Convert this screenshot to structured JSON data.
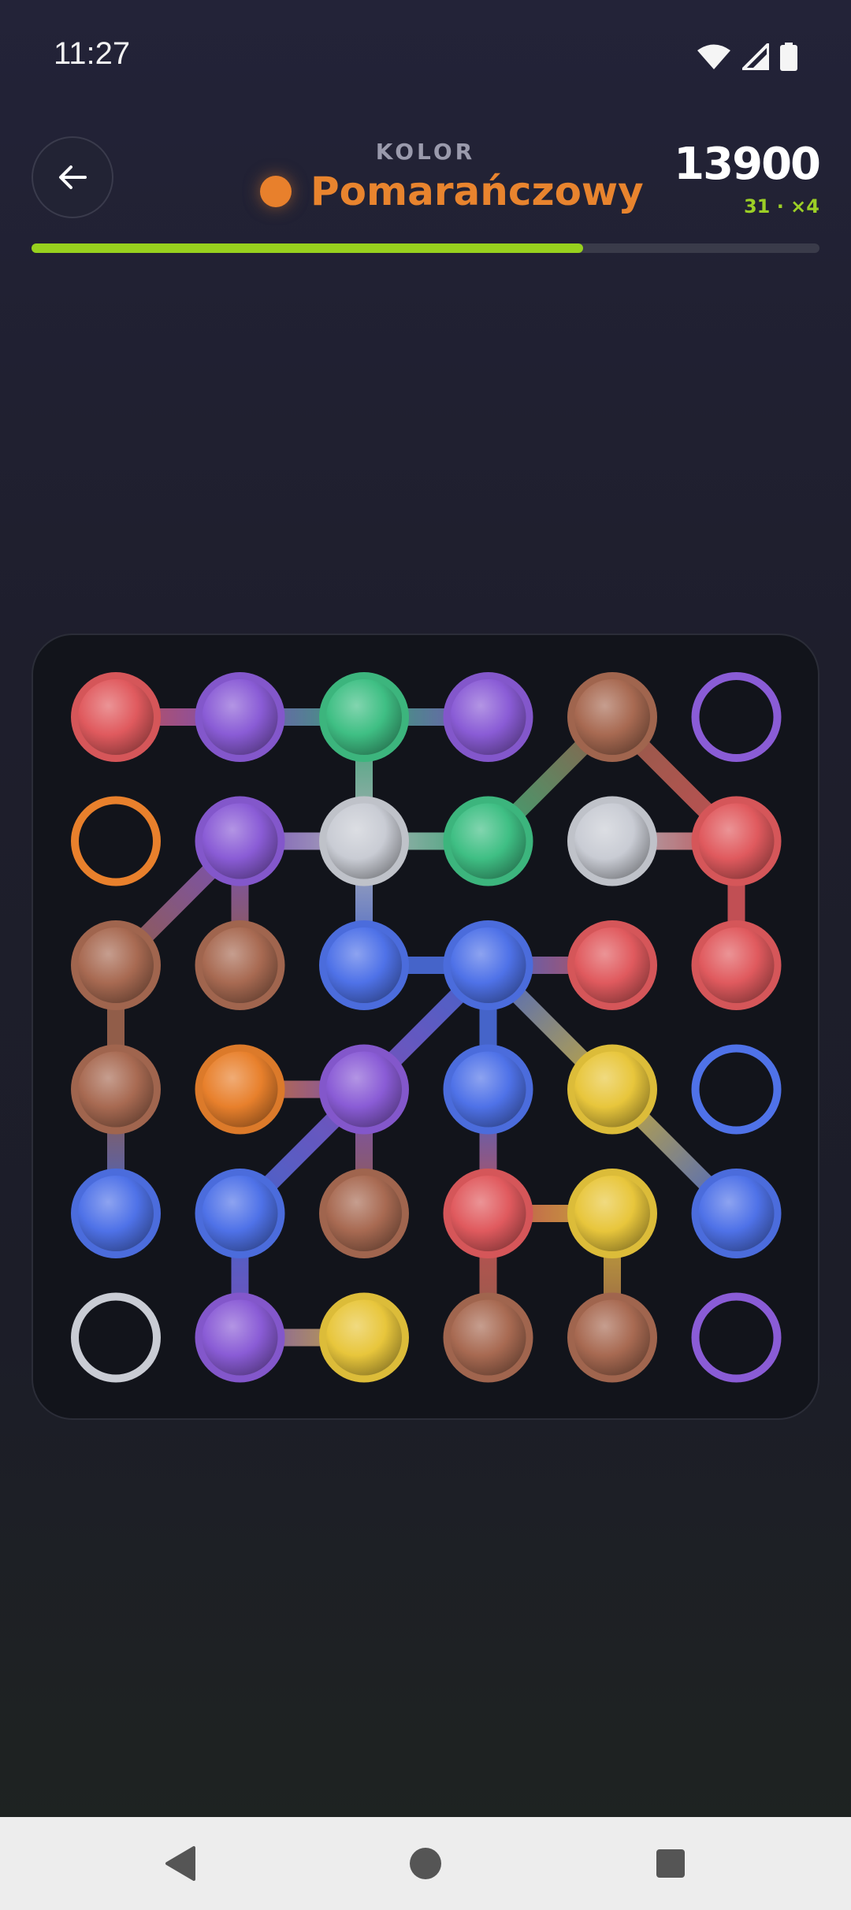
{
  "status": {
    "time": "11:27",
    "icons": [
      "wifi-icon",
      "cellular-signal-icon",
      "battery-icon"
    ]
  },
  "header": {
    "back_icon": "arrow-left-icon",
    "label": "KOLOR",
    "color_name": "Pomarańczowy",
    "color_hex": "#e8802c",
    "score": "13900",
    "combo": "31 · ×4",
    "progress": 0.7
  },
  "board": {
    "rows": 6,
    "cols": 6,
    "palette": {
      "red": "#e05a5e",
      "purple": "#8a5cd6",
      "green": "#3fbf84",
      "brown": "#a86a52",
      "white": "#c9ccd4",
      "blue": "#4f72e8",
      "orange": "#e8802c",
      "yellow": "#e8c63c"
    },
    "cells": [
      [
        {
          "c": "red",
          "f": true
        },
        {
          "c": "purple",
          "f": true
        },
        {
          "c": "green",
          "f": true
        },
        {
          "c": "purple",
          "f": true
        },
        {
          "c": "brown",
          "f": true
        },
        {
          "c": "purple",
          "f": false
        }
      ],
      [
        {
          "c": "orange",
          "f": false
        },
        {
          "c": "purple",
          "f": true
        },
        {
          "c": "white",
          "f": true
        },
        {
          "c": "green",
          "f": true
        },
        {
          "c": "white",
          "f": true
        },
        {
          "c": "red",
          "f": true
        }
      ],
      [
        {
          "c": "brown",
          "f": true
        },
        {
          "c": "brown",
          "f": true
        },
        {
          "c": "blue",
          "f": true
        },
        {
          "c": "blue",
          "f": true
        },
        {
          "c": "red",
          "f": true
        },
        {
          "c": "red",
          "f": true
        }
      ],
      [
        {
          "c": "brown",
          "f": true
        },
        {
          "c": "orange",
          "f": true
        },
        {
          "c": "purple",
          "f": true
        },
        {
          "c": "blue",
          "f": true
        },
        {
          "c": "yellow",
          "f": true
        },
        {
          "c": "blue",
          "f": false
        }
      ],
      [
        {
          "c": "blue",
          "f": true
        },
        {
          "c": "blue",
          "f": true
        },
        {
          "c": "brown",
          "f": true
        },
        {
          "c": "red",
          "f": true
        },
        {
          "c": "yellow",
          "f": true
        },
        {
          "c": "blue",
          "f": true
        }
      ],
      [
        {
          "c": "white",
          "f": false
        },
        {
          "c": "purple",
          "f": true
        },
        {
          "c": "yellow",
          "f": true
        },
        {
          "c": "brown",
          "f": true
        },
        {
          "c": "brown",
          "f": true
        },
        {
          "c": "purple",
          "f": false
        }
      ]
    ],
    "links": [
      [
        [
          0,
          0
        ],
        [
          0,
          1
        ]
      ],
      [
        [
          0,
          1
        ],
        [
          0,
          2
        ]
      ],
      [
        [
          0,
          2
        ],
        [
          0,
          3
        ]
      ],
      [
        [
          0,
          2
        ],
        [
          1,
          2
        ]
      ],
      [
        [
          0,
          4
        ],
        [
          1,
          3
        ]
      ],
      [
        [
          0,
          4
        ],
        [
          1,
          5
        ]
      ],
      [
        [
          1,
          1
        ],
        [
          1,
          2
        ]
      ],
      [
        [
          1,
          2
        ],
        [
          1,
          3
        ]
      ],
      [
        [
          1,
          1
        ],
        [
          2,
          0
        ]
      ],
      [
        [
          1,
          1
        ],
        [
          2,
          1
        ]
      ],
      [
        [
          1,
          2
        ],
        [
          2,
          2
        ]
      ],
      [
        [
          1,
          4
        ],
        [
          1,
          5
        ]
      ],
      [
        [
          1,
          5
        ],
        [
          2,
          5
        ]
      ],
      [
        [
          2,
          0
        ],
        [
          3,
          0
        ]
      ],
      [
        [
          2,
          2
        ],
        [
          2,
          3
        ]
      ],
      [
        [
          2,
          3
        ],
        [
          2,
          4
        ]
      ],
      [
        [
          2,
          3
        ],
        [
          3,
          2
        ]
      ],
      [
        [
          2,
          3
        ],
        [
          3,
          3
        ]
      ],
      [
        [
          2,
          3
        ],
        [
          3,
          4
        ]
      ],
      [
        [
          3,
          0
        ],
        [
          4,
          0
        ]
      ],
      [
        [
          3,
          1
        ],
        [
          3,
          2
        ]
      ],
      [
        [
          3,
          2
        ],
        [
          4,
          1
        ]
      ],
      [
        [
          3,
          2
        ],
        [
          4,
          2
        ]
      ],
      [
        [
          3,
          3
        ],
        [
          4,
          3
        ]
      ],
      [
        [
          3,
          4
        ],
        [
          4,
          5
        ]
      ],
      [
        [
          4,
          1
        ],
        [
          5,
          1
        ]
      ],
      [
        [
          4,
          3
        ],
        [
          4,
          4
        ]
      ],
      [
        [
          4,
          3
        ],
        [
          5,
          3
        ]
      ],
      [
        [
          4,
          4
        ],
        [
          5,
          4
        ]
      ],
      [
        [
          5,
          1
        ],
        [
          5,
          2
        ]
      ]
    ]
  },
  "nav": {
    "back_icon": "nav-back-icon",
    "home_icon": "nav-home-icon",
    "recents_icon": "nav-recents-icon"
  }
}
